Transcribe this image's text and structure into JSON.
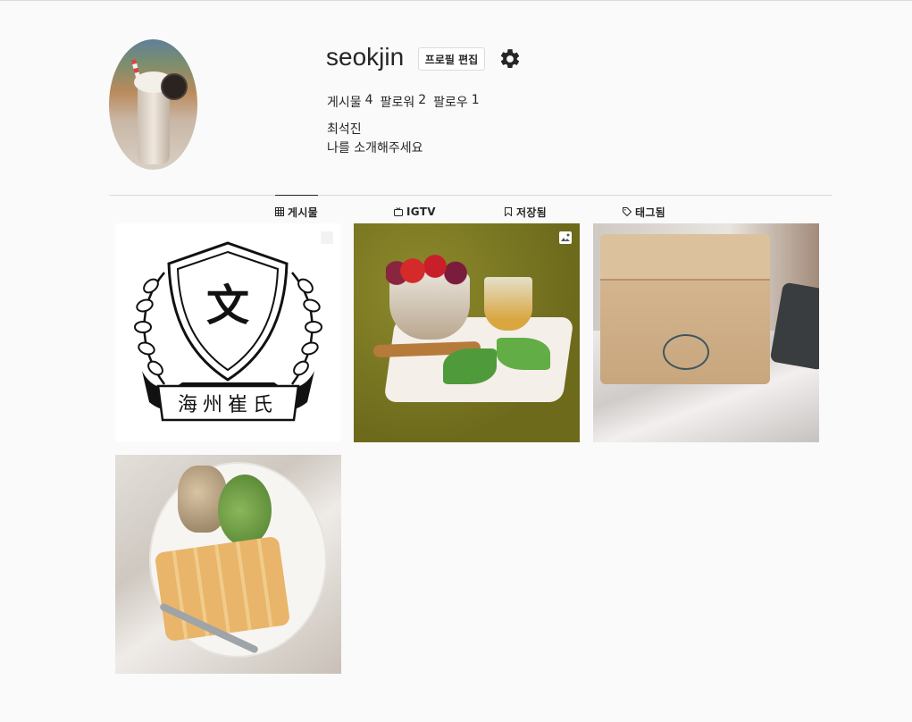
{
  "profile": {
    "username": "seokjin",
    "edit_label": "프로필 편집",
    "stats": [
      {
        "label": "게시물",
        "value": "4"
      },
      {
        "label": "팔로워",
        "value": "2"
      },
      {
        "label": "팔로우",
        "value": "1"
      }
    ],
    "full_name": "최석진",
    "bio": "나를 소개해주세요"
  },
  "tabs": [
    {
      "label": "게시물",
      "icon": "grid-icon"
    },
    {
      "label": "IGTV",
      "icon": "tv-icon"
    },
    {
      "label": "저장됨",
      "icon": "bookmark-icon"
    },
    {
      "label": "태그됨",
      "icon": "tag-icon"
    }
  ],
  "posts": [
    {
      "emblem_char": "文",
      "caption_text": "海州崔氏",
      "multi": true
    },
    {
      "multi": true
    },
    {
      "multi": false
    },
    {
      "multi": false
    }
  ],
  "colors": {
    "text": "#262626",
    "border": "#dbdbdb",
    "background": "#fafafa"
  }
}
